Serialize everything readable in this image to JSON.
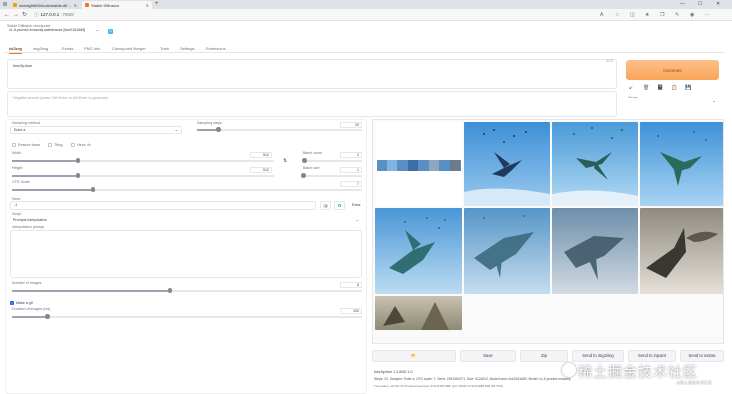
{
  "browser": {
    "tabs": [
      {
        "title": "midnightM3r0ode/stable-diffusio..."
      },
      {
        "title": "Stable Diffusion"
      }
    ],
    "address": {
      "url_host": "127.0.0.1",
      "url_path": ":7860/"
    }
  },
  "app": {
    "checkpoint_label": "Stable Diffusion checkpoint",
    "checkpoint_value": "v1-5-pruned-emaonly.safetensors [6ce0161689]",
    "tabs": [
      "txt2img",
      "img2img",
      "Extras",
      "PNG Info",
      "Checkpoint Merger",
      "Train",
      "Settings",
      "Extensions"
    ],
    "prompt": "bird,fly,blue",
    "prompt_counter": "5/75",
    "negative_placeholder": "Negative prompt (press Ctrl+Enter or Alt+Enter to generate)",
    "generate_label": "Generate",
    "styles_label": "Styles",
    "tool_icons": [
      "↙",
      "🗑",
      "📓",
      "📋",
      "💾"
    ],
    "sampling_method_label": "Sampling method",
    "sampling_method_value": "Euler a",
    "sampling_steps_label": "Sampling steps",
    "sampling_steps_value": "20",
    "restore_faces_label": "Restore faces",
    "tiling_label": "Tiling",
    "hires_label": "Hires. fix",
    "width_label": "Width",
    "width_value": "512",
    "height_label": "Height",
    "height_value": "512",
    "swap_icon": "⇅",
    "batch_count_label": "Batch count",
    "batch_count_value": "2",
    "batch_size_label": "Batch size",
    "batch_size_value": "1",
    "cfg_label": "CFG Scale",
    "cfg_value": "7",
    "seed_label": "Seed",
    "seed_value": "-1",
    "dice_icon": "🎲",
    "recycle_icon": "♻",
    "extra_label": "Extra",
    "script_label": "Script",
    "script_value": "Prompts interpolation",
    "interp_label": "Interpolation prompt",
    "images_count_label": "Number of images",
    "images_count_value": "8",
    "make_gif_label": "Make a gif",
    "duration_label": "Duration of images (ms)",
    "duration_value": "100",
    "action_buttons": [
      {
        "label": "📂"
      },
      {
        "label": "Save"
      },
      {
        "label": "Zip"
      },
      {
        "label": "Send to img2img"
      },
      {
        "label": "Send to inpaint"
      },
      {
        "label": "Send to extras"
      }
    ],
    "info_prompt": "bird,fly,blue 1.3 AND 1.0",
    "info_params": "Steps: 20, Sampler: Euler a, CFG scale: 7, Seed: 2931590271, Size: 512x512, Model hash: 6ce0161689, Model: v1-5-pruned-emaonly",
    "info_time": "Time taken: 18.16s  Torch active/reserved: 3711/4490 MiB, Sys VRAM: 6732/12288 MiB (54.79%)",
    "watermark_text": "稀土掘金技术社区",
    "watermark_handle": "@稀土掘金技术社区"
  },
  "sliders": {
    "sampling_steps": 0.13,
    "width": 0.25,
    "height": 0.25,
    "batch_count": 0.02,
    "batch_size": 0.0,
    "cfg": 0.23,
    "images_count": 0.45,
    "duration": 0.1
  }
}
